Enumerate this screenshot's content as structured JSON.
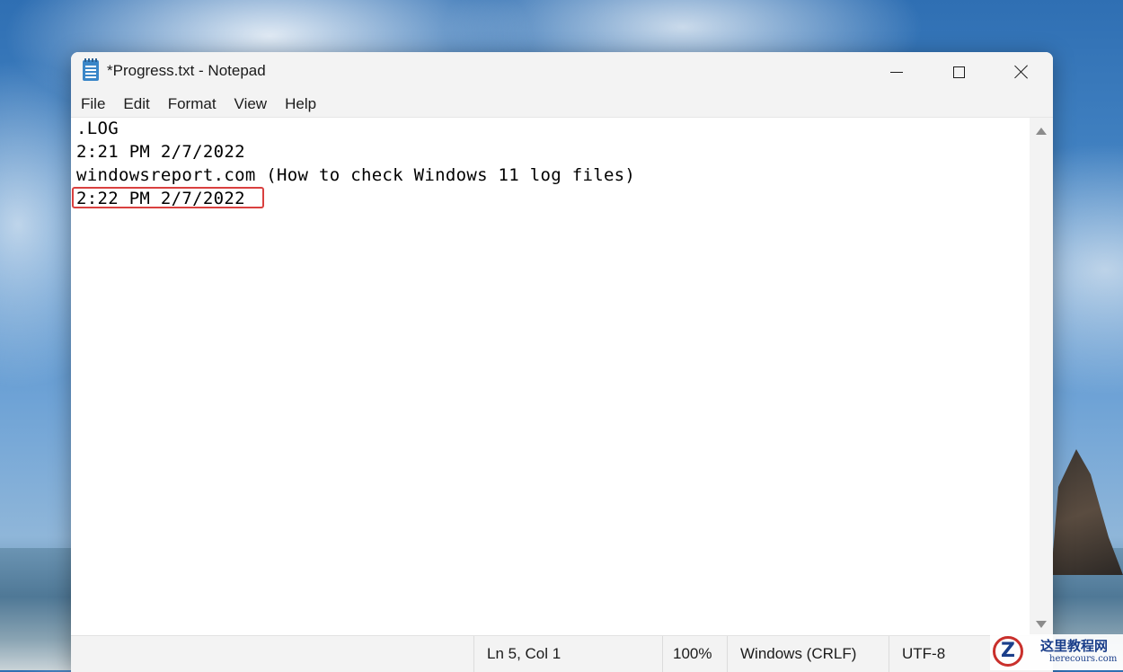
{
  "window": {
    "title": "*Progress.txt - Notepad",
    "icon": "notepad-icon",
    "controls": [
      "minimize-icon",
      "maximize-icon",
      "close-icon"
    ]
  },
  "menu": {
    "items": [
      {
        "label": "File"
      },
      {
        "label": "Edit"
      },
      {
        "label": "Format"
      },
      {
        "label": "View"
      },
      {
        "label": "Help"
      }
    ]
  },
  "editor": {
    "lines": [
      ".LOG",
      "2:21 PM 2/7/2022",
      "windowsreport.com (How to check Windows 11 log files)",
      "2:22 PM 2/7/2022"
    ],
    "highlight_color": "#d9403f"
  },
  "status": {
    "position": "Ln 5, Col 1",
    "zoom": "100%",
    "line_endings": "Windows (CRLF)",
    "encoding": "UTF-8"
  },
  "watermark": {
    "logo_letter": "Z",
    "name": "这里教程网",
    "site": "herecours.com"
  },
  "colors": {
    "chrome": "#f3f3f3",
    "text": "#1b1b1b"
  }
}
